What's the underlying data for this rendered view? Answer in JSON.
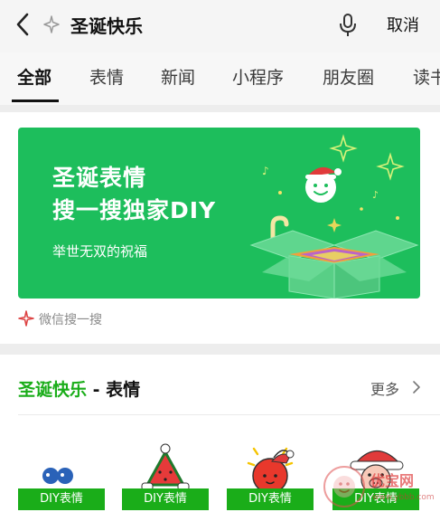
{
  "search": {
    "query": "圣诞快乐",
    "cancel_label": "取消"
  },
  "tabs": [
    {
      "label": "全部",
      "active": true
    },
    {
      "label": "表情"
    },
    {
      "label": "新闻"
    },
    {
      "label": "小程序"
    },
    {
      "label": "朋友圈"
    },
    {
      "label": "读书"
    }
  ],
  "banner": {
    "title_line1": "圣诞表情",
    "title_line2": "搜一搜独家DIY",
    "subtitle": "举世无双的祝福",
    "bg_color": "#1dbe5c"
  },
  "source": {
    "label": "微信搜一搜"
  },
  "section": {
    "title_highlight": "圣诞快乐",
    "title_rest": " - 表情",
    "more_label": "更多",
    "accent_color": "#1aad19"
  },
  "stickers": [
    {
      "label": "DIY表情",
      "icon": "blue-blob-sticker-icon"
    },
    {
      "label": "DIY表情",
      "icon": "watermelon-santa-hat-sticker-icon"
    },
    {
      "label": "DIY表情",
      "icon": "apple-santa-hat-sticker-icon"
    },
    {
      "label": "DIY表情",
      "icon": "santa-pig-sticker-icon"
    }
  ],
  "watermark": {
    "text": "优宝网",
    "sub": "www.ybbb.com"
  }
}
